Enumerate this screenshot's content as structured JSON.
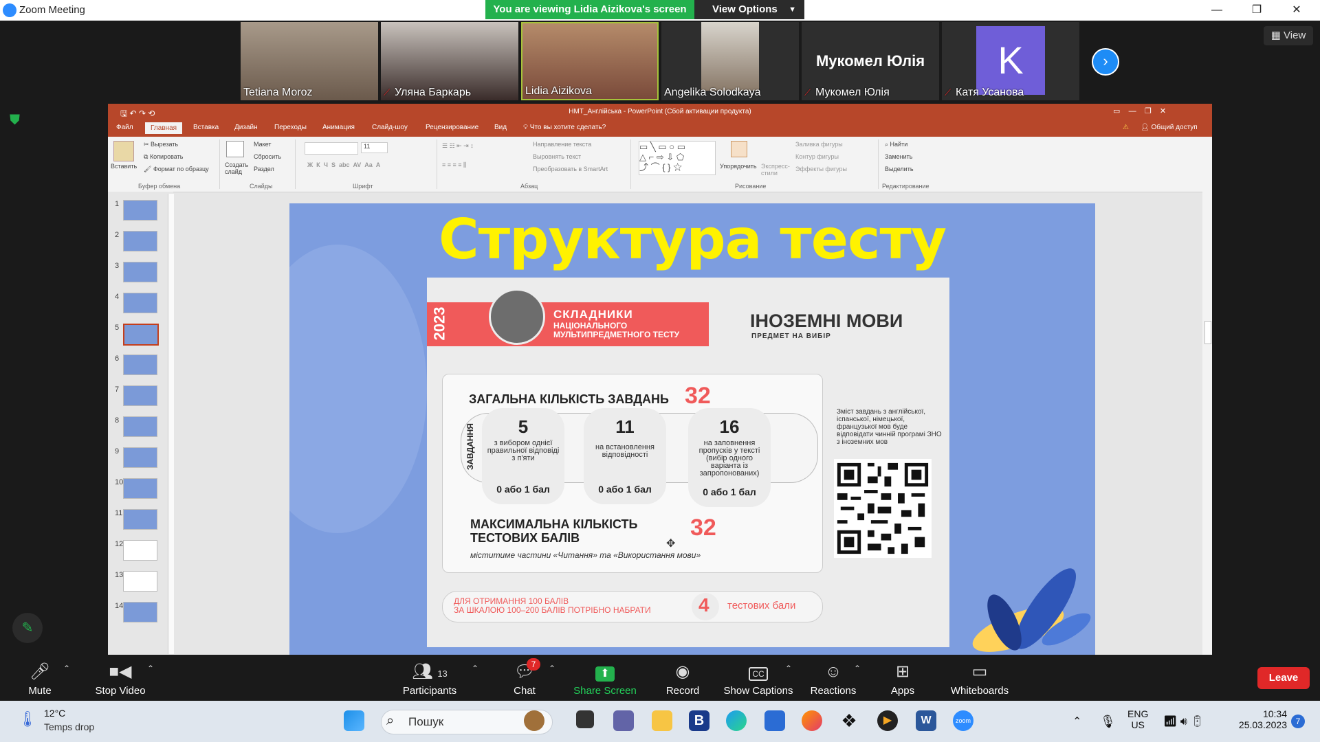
{
  "window": {
    "title": "Zoom Meeting",
    "viewing_banner": "You are viewing Lidia Aizikova's screen",
    "view_options": "View Options",
    "view_button": "View"
  },
  "participants_strip": [
    {
      "name": "Tetiana Moroz",
      "muted": false
    },
    {
      "name": "Уляна Баркарь",
      "muted": true
    },
    {
      "name": "Lidia Aizikova",
      "muted": false
    },
    {
      "name": "Angelika Solodkaya",
      "muted": false
    },
    {
      "name": "Мукомел Юлія",
      "muted": true,
      "display_title": "Мукомел Юлія"
    },
    {
      "name": "Катя Усанова",
      "muted": true,
      "avatar_letter": "K"
    }
  ],
  "ppt": {
    "title": "НМТ_Англійська - PowerPoint (Сбой активации продукта)",
    "tabs": [
      "Файл",
      "Главная",
      "Вставка",
      "Дизайн",
      "Переходы",
      "Анимация",
      "Слайд-шоу",
      "Рецензирование",
      "Вид",
      "Что вы хотите сделать?"
    ],
    "share": "Общий доступ",
    "ribbon": {
      "paste": "Вставить",
      "cut": "Вырезать",
      "copy": "Копировать",
      "format_painter": "Формат по образцу",
      "clipboard": "Буфер обмена",
      "new_slide": "Создать слайд",
      "layout": "Макет",
      "reset": "Сбросить",
      "section": "Раздел",
      "slides": "Слайды",
      "font_size": "11",
      "font": "Шрифт",
      "text_direction": "Направление текста",
      "align_text": "Выровнять текст",
      "smartart": "Преобразовать в SmartArt",
      "paragraph": "Абзац",
      "arrange": "Упорядочить",
      "quick_styles": "Экспресс-стили",
      "shape_fill": "Заливка фигуры",
      "shape_outline": "Контур фигуры",
      "shape_effects": "Эффекты фигуры",
      "drawing": "Рисование",
      "find": "Найти",
      "replace": "Заменить",
      "select": "Выделить",
      "editing": "Редактирование"
    },
    "thumbnails": [
      "1",
      "2",
      "3",
      "4",
      "5",
      "6",
      "7",
      "8",
      "9",
      "10",
      "11",
      "12",
      "13",
      "14"
    ],
    "selected_slide": "5"
  },
  "slide": {
    "title": "Структура тесту",
    "year": "2023",
    "banner_h1": "СКЛАДНИКИ",
    "banner_h2a": "НАЦІОНАЛЬНОГО",
    "banner_h2b": "МУЛЬТИПРЕДМЕТНОГО ТЕСТУ",
    "lang": "ІНОЗЕМНІ МОВИ",
    "lang_sub": "ПРЕДМЕТ НА ВИБІР",
    "total_label": "ЗАГАЛЬНА КІЛЬКІСТЬ ЗАВДАНЬ",
    "total_value": "32",
    "tasks_label": "ЗАВДАННЯ",
    "task_types": [
      {
        "count": "5",
        "desc": "з вибором однієї правильної відповіді з п'яти",
        "points": "0 або 1 бал"
      },
      {
        "count": "11",
        "desc": "на встановлення відповідності",
        "points": "0 або 1 бал"
      },
      {
        "count": "16",
        "desc": "на заповнення пропусків у тексті (вибір одного варіанта із запропонованих)",
        "points": "0 або 1 бал"
      }
    ],
    "max_label": "МАКСИМАЛЬНА КІЛЬКІСТЬ ТЕСТОВИХ БАЛІВ",
    "max_value": "32",
    "max_note": "міститиме частини «Читання» та «Використання мови»",
    "side_text": "Зміст завдань з англійської, іспанської, німецької, французької мов буде відповідати чинній програмі ЗНО з іноземних мов",
    "bottom_line1": "ДЛЯ ОТРИМАННЯ 100 БАЛІВ",
    "bottom_line2": "ЗА ШКАЛОЮ 100–200 БАЛІВ ПОТРІБНО НАБРАТИ",
    "bottom_num": "4",
    "bottom_unit": "тестових бали"
  },
  "toolbar": {
    "mute": "Mute",
    "stop_video": "Stop Video",
    "participants": "Participants",
    "participants_count": "13",
    "chat": "Chat",
    "chat_badge": "7",
    "share": "Share Screen",
    "record": "Record",
    "captions": "Show Captions",
    "reactions": "Reactions",
    "apps": "Apps",
    "whiteboards": "Whiteboards",
    "leave": "Leave"
  },
  "taskbar": {
    "temp": "12°C",
    "weather": "Temps drop",
    "search": "Пошук",
    "lang1": "ENG",
    "lang2": "US",
    "time": "10:34",
    "date": "25.03.2023",
    "notif": "7"
  },
  "colors": {
    "ppt_red": "#b7472a",
    "zoom_green": "#23b14d",
    "leave_red": "#e02828",
    "slide_bg": "#7d9ddf",
    "title_yellow": "#fff200",
    "accent_red": "#f05a5a"
  }
}
